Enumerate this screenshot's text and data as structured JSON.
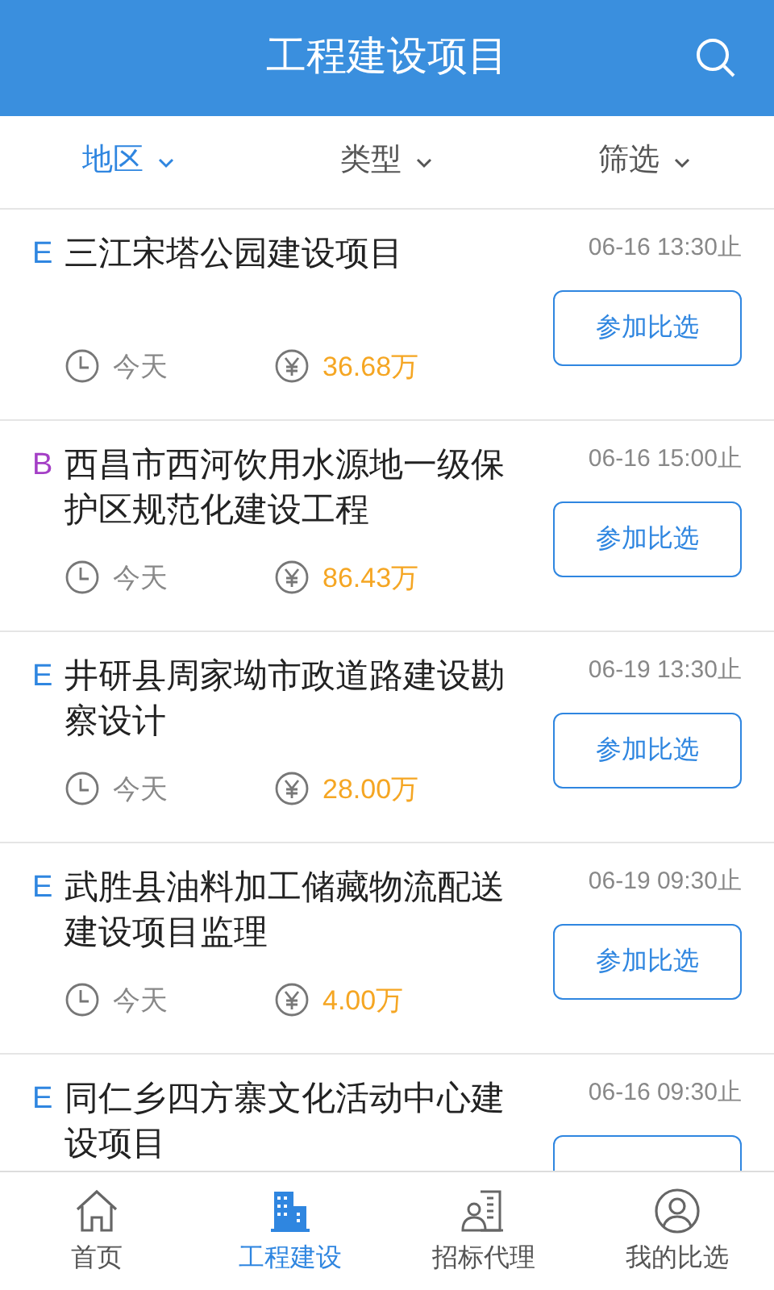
{
  "header": {
    "title": "工程建设项目"
  },
  "filters": [
    {
      "label": "地区",
      "selected": true
    },
    {
      "label": "类型",
      "selected": false
    },
    {
      "label": "筛选",
      "selected": false
    }
  ],
  "projects": [
    {
      "tag": "E",
      "color": "#2f86e0",
      "title": "三江宋塔公园建设项目",
      "deadline": "06-16 13:30止",
      "date": "今天",
      "amount": "36.68万",
      "action": "参加比选"
    },
    {
      "tag": "B",
      "color": "#a43fc6",
      "title": "西昌市西河饮用水源地一级保护区规范化建设工程",
      "deadline": "06-16 15:00止",
      "date": "今天",
      "amount": "86.43万",
      "action": "参加比选"
    },
    {
      "tag": "E",
      "color": "#2f86e0",
      "title": "井研县周家坳市政道路建设勘察设计",
      "deadline": "06-19 13:30止",
      "date": "今天",
      "amount": "28.00万",
      "action": "参加比选"
    },
    {
      "tag": "E",
      "color": "#2f86e0",
      "title": "武胜县油料加工储藏物流配送建设项目监理",
      "deadline": "06-19 09:30止",
      "date": "今天",
      "amount": "4.00万",
      "action": "参加比选"
    },
    {
      "tag": "E",
      "color": "#2f86e0",
      "title": "同仁乡四方寨文化活动中心建设项目",
      "deadline": "06-16 09:30止"
    }
  ],
  "nav": [
    {
      "kind": "home",
      "label": "首页",
      "selected": false
    },
    {
      "kind": "building",
      "label": "工程建设",
      "selected": true
    },
    {
      "kind": "agent",
      "label": "招标代理",
      "selected": false
    },
    {
      "kind": "user",
      "label": "我的比选",
      "selected": false
    }
  ]
}
